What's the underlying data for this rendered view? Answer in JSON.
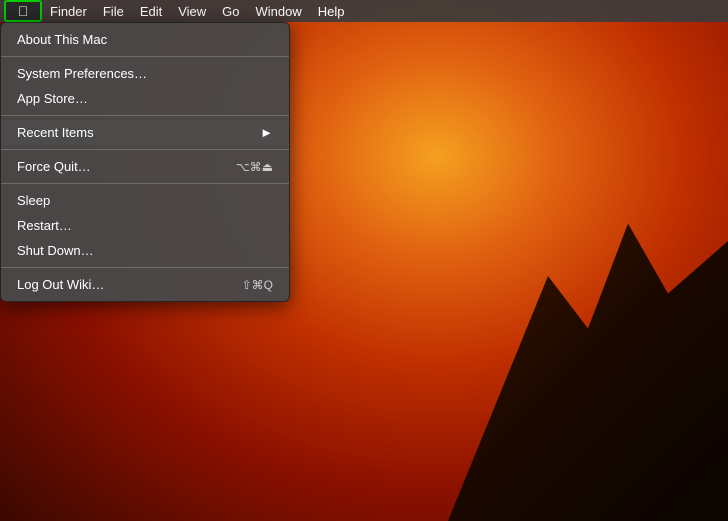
{
  "menubar": {
    "apple_label": "",
    "items": [
      {
        "id": "finder",
        "label": "Finder",
        "active": false
      },
      {
        "id": "file",
        "label": "File",
        "active": false
      },
      {
        "id": "edit",
        "label": "Edit",
        "active": false
      },
      {
        "id": "view",
        "label": "View",
        "active": false
      },
      {
        "id": "go",
        "label": "Go",
        "active": false
      },
      {
        "id": "window",
        "label": "Window",
        "active": false
      },
      {
        "id": "help",
        "label": "Help",
        "active": false
      }
    ]
  },
  "dropdown": {
    "items": [
      {
        "id": "about",
        "label": "About This Mac",
        "shortcut": "",
        "arrow": false,
        "separator_after": false
      },
      {
        "id": "sep1",
        "separator": true
      },
      {
        "id": "system-prefs",
        "label": "System Preferences…",
        "shortcut": "",
        "arrow": false,
        "separator_after": false
      },
      {
        "id": "app-store",
        "label": "App Store…",
        "shortcut": "",
        "arrow": false,
        "separator_after": false
      },
      {
        "id": "sep2",
        "separator": true
      },
      {
        "id": "recent-items",
        "label": "Recent Items",
        "shortcut": "",
        "arrow": true,
        "separator_after": false
      },
      {
        "id": "sep3",
        "separator": true
      },
      {
        "id": "force-quit",
        "label": "Force Quit…",
        "shortcut": "⌥⌘⏻",
        "arrow": false,
        "separator_after": false
      },
      {
        "id": "sep4",
        "separator": true
      },
      {
        "id": "sleep",
        "label": "Sleep",
        "shortcut": "",
        "arrow": false,
        "separator_after": false
      },
      {
        "id": "restart",
        "label": "Restart…",
        "shortcut": "",
        "arrow": false,
        "separator_after": false
      },
      {
        "id": "shutdown",
        "label": "Shut Down…",
        "shortcut": "",
        "arrow": false,
        "separator_after": false
      },
      {
        "id": "sep5",
        "separator": true
      },
      {
        "id": "logout",
        "label": "Log Out Wiki…",
        "shortcut": "⇧⌘Q",
        "arrow": false,
        "separator_after": false
      }
    ]
  },
  "colors": {
    "apple_border": "#00cc00",
    "menu_bg": "rgba(72,72,72,0.97)",
    "highlight": "rgba(56,117,215,0.85)"
  }
}
